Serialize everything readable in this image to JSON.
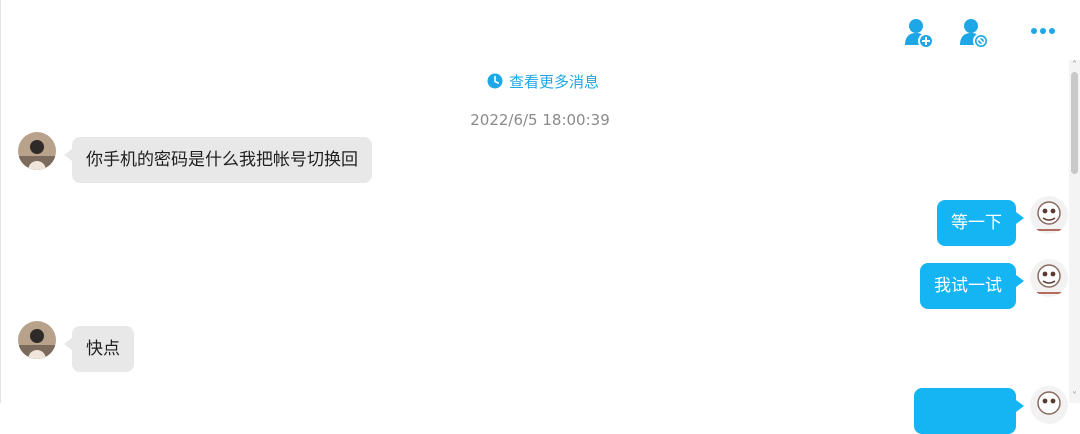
{
  "toolbar": {
    "icons": [
      "add-contact-icon",
      "block-contact-icon",
      "more-icon"
    ],
    "accent_color": "#1ea7e6"
  },
  "chat": {
    "load_more_label": "查看更多消息",
    "timestamp": "2022/6/5 18:00:39",
    "messages": [
      {
        "side": "left",
        "text": "你手机的密码是什么我把帐号切换回"
      },
      {
        "side": "right",
        "text": "等一下"
      },
      {
        "side": "right",
        "text": "我试一试"
      },
      {
        "side": "left",
        "text": "快点"
      },
      {
        "side": "right",
        "text": ""
      }
    ],
    "bubble_colors": {
      "left": "#e8e8e8",
      "right": "#15b5f3"
    }
  },
  "scrollbar": {
    "up_glyph": "˄",
    "down_glyph": "˅"
  }
}
